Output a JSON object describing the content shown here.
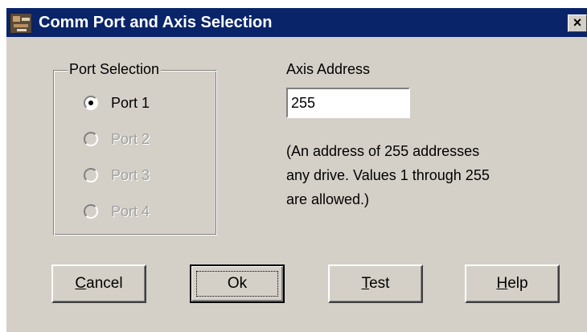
{
  "window": {
    "title": "Comm Port and Axis Selection",
    "close_label": "×"
  },
  "port_selection": {
    "title": "Port Selection",
    "options": [
      {
        "label": "Port 1",
        "selected": true,
        "enabled": true
      },
      {
        "label": "Port 2",
        "selected": false,
        "enabled": false
      },
      {
        "label": "Port 3",
        "selected": false,
        "enabled": false
      },
      {
        "label": "Port 4",
        "selected": false,
        "enabled": false
      }
    ]
  },
  "axis": {
    "label": "Axis Address",
    "value": "255",
    "note_lines": [
      "(An address of 255 addresses",
      "any drive. Values 1 through 255",
      "are allowed.)"
    ]
  },
  "buttons": {
    "cancel": {
      "mnemonic": "C",
      "rest": "ancel"
    },
    "ok": {
      "label": "Ok"
    },
    "test": {
      "mnemonic": "T",
      "rest": "est"
    },
    "help": {
      "mnemonic": "H",
      "rest": "elp"
    }
  },
  "colors": {
    "titlebar": "#0a246a",
    "face": "#d4d0c8",
    "disabled_text": "#a0a0a0"
  }
}
